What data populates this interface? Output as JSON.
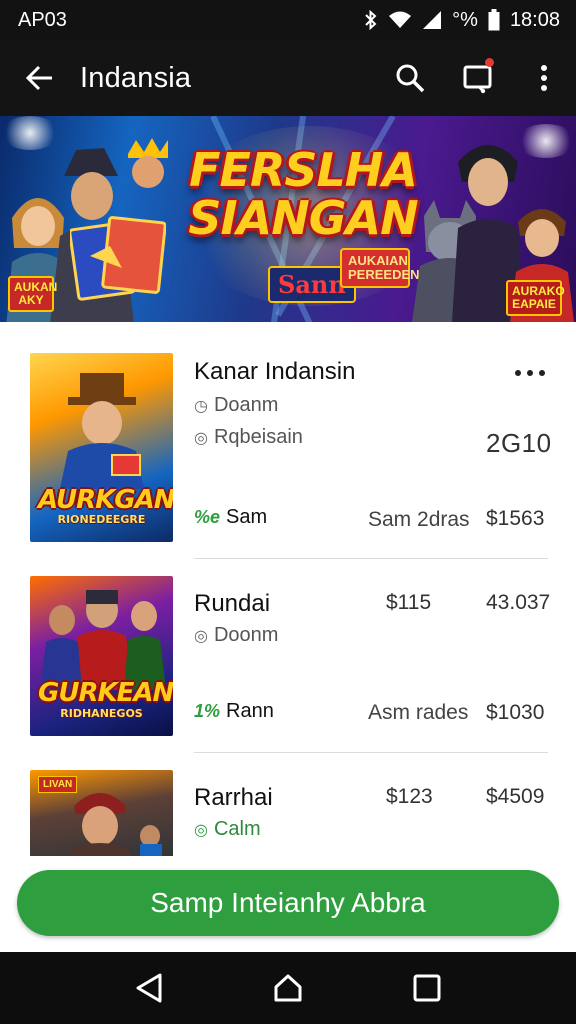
{
  "status_bar": {
    "carrier": "AP03",
    "battery_percent": "°%",
    "time": "18:08",
    "icons": [
      "bluetooth-icon",
      "wifi-icon",
      "signal-icon",
      "battery-icon"
    ]
  },
  "app_bar": {
    "title": "Indansia",
    "icons": [
      "back-arrow-icon",
      "search-icon",
      "cart-icon",
      "more-vertical-icon"
    ],
    "accent": "#141414"
  },
  "banner": {
    "title_line1": "FERSLHA",
    "title_line2": "SIANGAN",
    "tag_primary": "Sann",
    "tag_secondary": "AUKAIAN PEREEDEN",
    "side_left": "AUKAN AKY",
    "side_right": "AURAKO EAPAIE"
  },
  "items": [
    {
      "title": "Kanar Indansin",
      "meta1": "Doanm",
      "meta2": "Rqbeisain",
      "number": "2G10",
      "tag_icon": "%e",
      "tag_label": "Sam",
      "secondary": "Sam 2dras",
      "price": "$1563",
      "thumb_title": "AURKGAN",
      "thumb_sub": "RIONEDEEGRE"
    },
    {
      "title": "Rundai",
      "meta1": "Doonm",
      "price_top": "$115",
      "number": "43.037",
      "tag_icon": "1%",
      "tag_label": "Rann",
      "secondary": "Asm rades",
      "price": "$1030",
      "thumb_title": "GURKEAN",
      "thumb_sub": "RIDHANEGOS"
    },
    {
      "title": "Rarrhai",
      "meta1": "Calm",
      "price_top": "$123",
      "number": "$4509",
      "thumb_title": "LIVAN"
    }
  ],
  "cta": {
    "label": "Samp Inteianhy Abbra",
    "color": "#2e9e3f"
  },
  "nav": {
    "icons": [
      "back-triangle-icon",
      "home-icon",
      "recents-icon"
    ]
  },
  "colors": {
    "green": "#2e9e3f",
    "dark": "#141414"
  }
}
